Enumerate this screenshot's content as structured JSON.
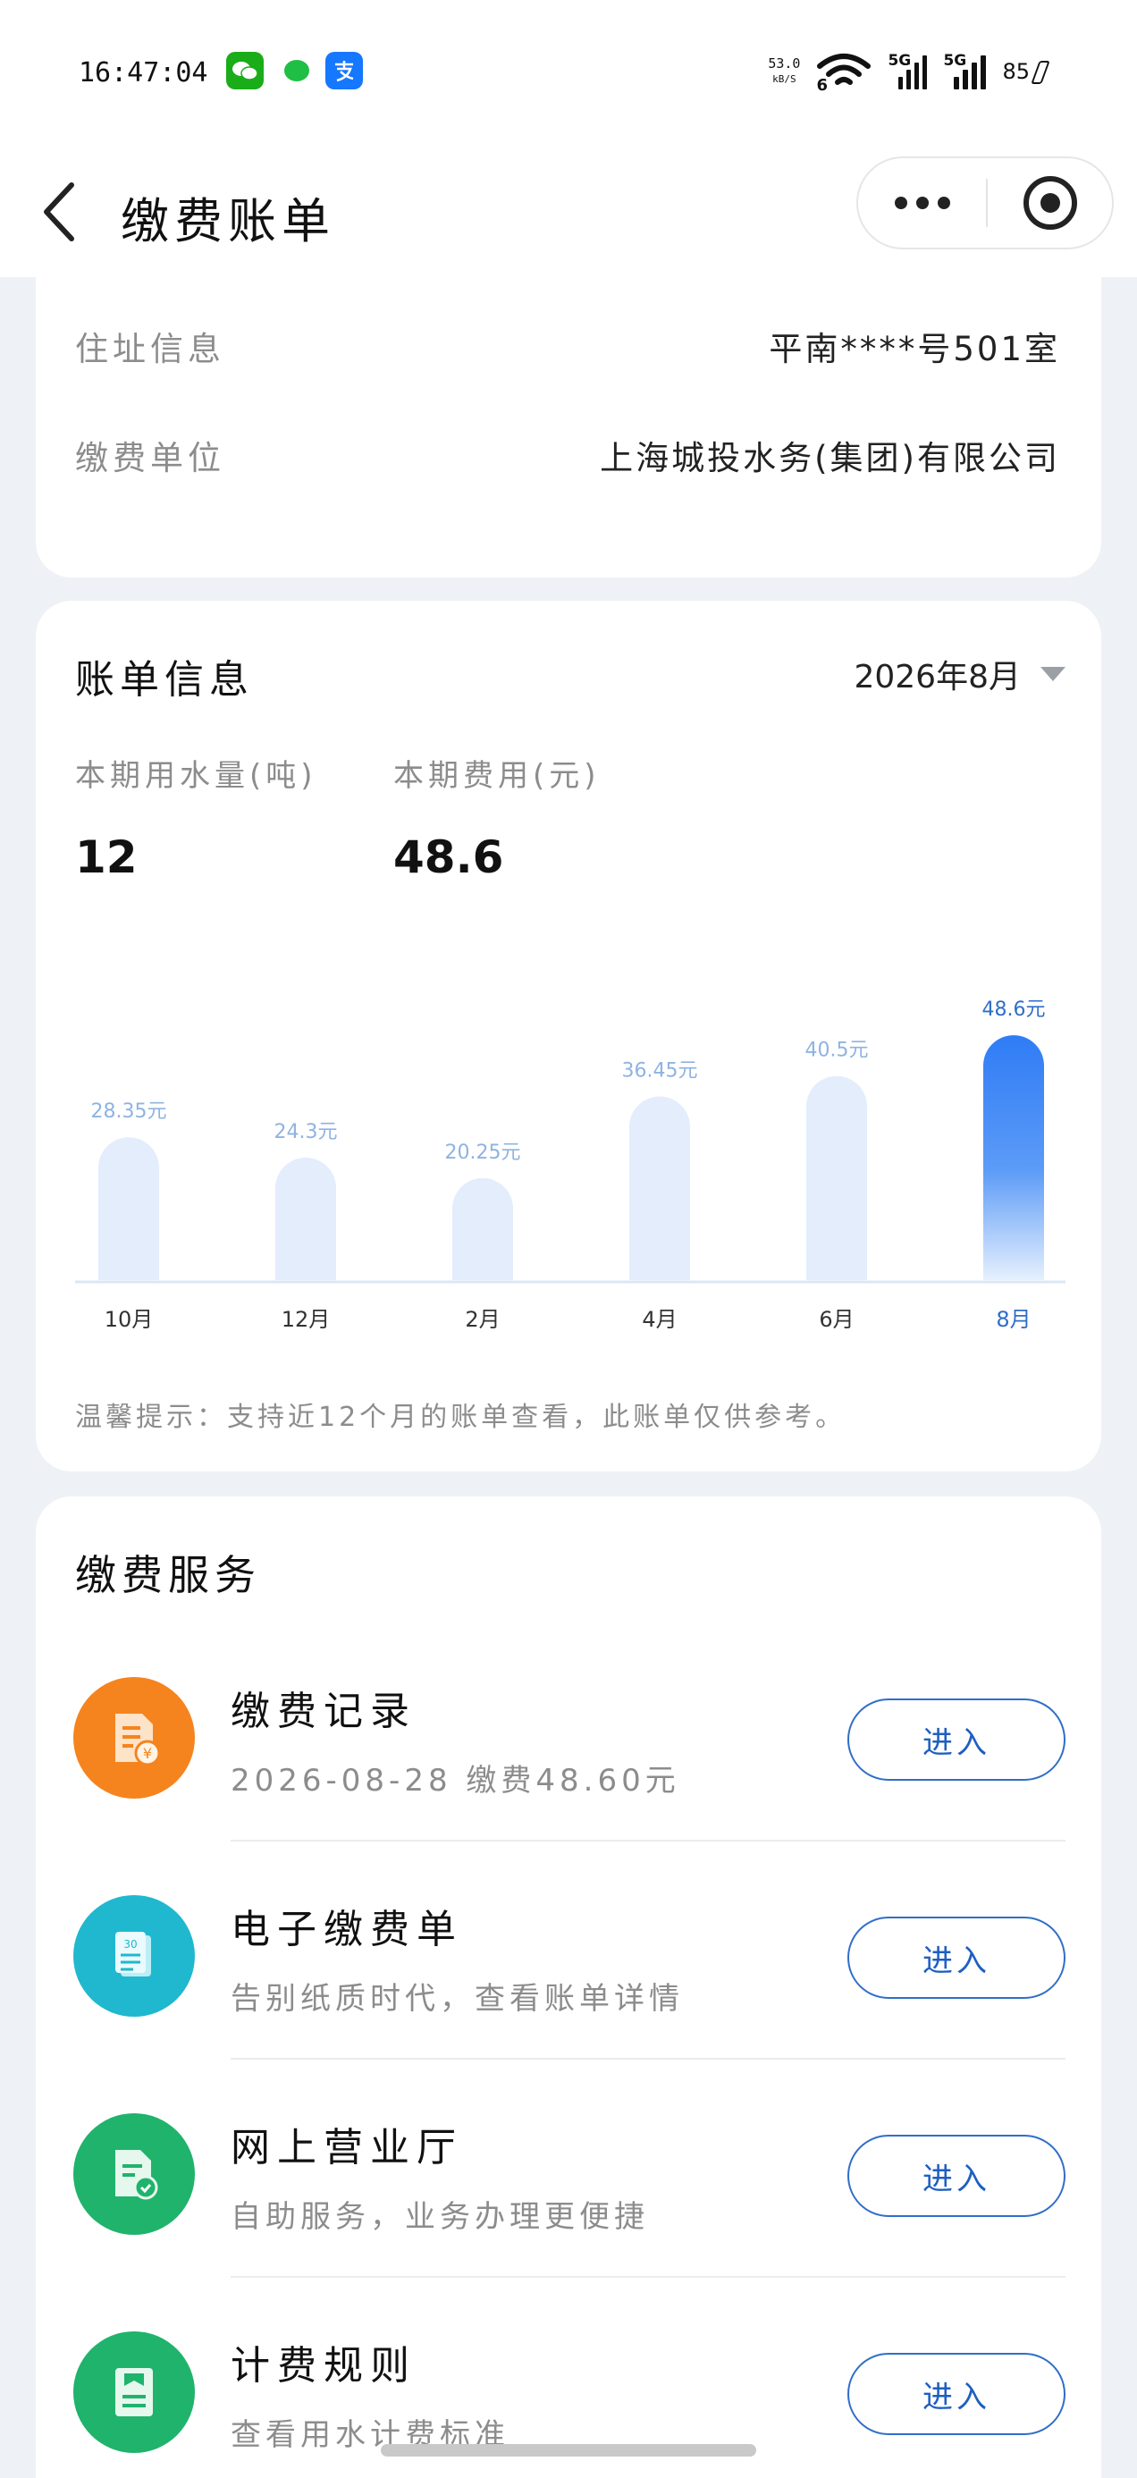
{
  "status_bar": {
    "time": "16:47:04",
    "net_speed_value": "53.0",
    "net_speed_unit": "kB/S",
    "wifi_label": "6",
    "signal1_label": "5G",
    "signal2_label": "5G",
    "battery": "85",
    "app_icons": [
      "wechat-icon",
      "message-icon",
      "alipay-icon"
    ]
  },
  "header": {
    "title": "缴费账单"
  },
  "address_card": {
    "rows": [
      {
        "label": "住址信息",
        "value": "平南****号501室"
      },
      {
        "label": "缴费单位",
        "value": "上海城投水务(集团)有限公司"
      }
    ]
  },
  "bill": {
    "title": "账单信息",
    "period": "2026年8月",
    "usage_label": "本期用水量(吨)",
    "usage_value": "12",
    "fee_label": "本期费用(元)",
    "fee_value": "48.6",
    "tip": "温馨提示：支持近12个月的账单查看，此账单仅供参考。"
  },
  "chart_data": {
    "type": "bar",
    "categories": [
      "10月",
      "12月",
      "2月",
      "4月",
      "6月",
      "8月"
    ],
    "values": [
      28.35,
      24.3,
      20.25,
      36.45,
      40.5,
      48.6
    ],
    "value_labels": [
      "28.35元",
      "24.3元",
      "20.25元",
      "36.45元",
      "40.5元",
      "48.6元"
    ],
    "highlight_index": 5,
    "ylim": [
      0,
      55
    ],
    "colors": {
      "bar": "#e3edfc",
      "highlight_top": "#2f7cf6",
      "highlight_bottom": "#e6f0fd",
      "label": "#8eb3e2",
      "highlight_label": "#2f6ec8",
      "axis": "#dbe7f7"
    }
  },
  "services": {
    "title": "缴费服务",
    "button_label": "进入",
    "items": [
      {
        "name": "缴费记录",
        "desc": "2026-08-28 缴费48.60元",
        "color": "#f5841f",
        "icon": "payment-record-icon"
      },
      {
        "name": "电子缴费单",
        "desc": "告别纸质时代，查看账单详情",
        "color": "#1fb8cf",
        "icon": "e-bill-icon"
      },
      {
        "name": "网上营业厅",
        "desc": "自助服务，业务办理更便捷",
        "color": "#1fb36c",
        "icon": "online-hall-icon"
      },
      {
        "name": "计费规则",
        "desc": "查看用水计费标准",
        "color": "#1fb36c",
        "icon": "billing-rule-icon"
      }
    ]
  }
}
